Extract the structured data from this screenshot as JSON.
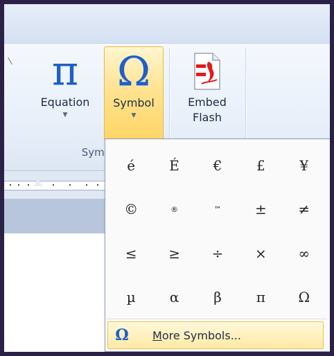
{
  "ribbon": {
    "equation": {
      "label": "Equation",
      "glyph": "π"
    },
    "symbol": {
      "label": "Symbol",
      "glyph": "Ω"
    },
    "embed_flash": {
      "label_line1": "Embed",
      "label_line2": "Flash"
    },
    "group_label": "Symb",
    "dropdown_arrow": "▼"
  },
  "symbols_menu": {
    "symbols": [
      "é",
      "É",
      "€",
      "£",
      "¥",
      "©",
      "®",
      "™",
      "±",
      "≠",
      "≤",
      "≥",
      "÷",
      "×",
      "∞",
      "µ",
      "α",
      "β",
      "π",
      "Ω"
    ],
    "more_symbols": {
      "icon_glyph": "Ω",
      "label_hotkey": "M",
      "label_rest": "ore Symbols..."
    }
  },
  "colors": {
    "accent_blue": "#1f5fc6",
    "highlight_gold": "#ffd666",
    "flash_red": "#e21b1b"
  }
}
